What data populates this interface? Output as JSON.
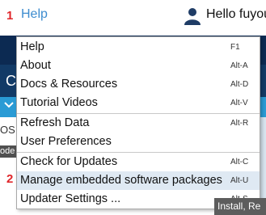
{
  "markers": {
    "step1": "1",
    "step2": "2"
  },
  "header": {
    "help_label": "Help",
    "greeting": "Hello fuyou"
  },
  "background": {
    "nav_letter": "C",
    "os_text": "OS",
    "dark_strip_text": "ode"
  },
  "menu": {
    "items": [
      {
        "label": "Help",
        "shortcut": "F1"
      },
      {
        "label": "About",
        "shortcut": "Alt-A"
      },
      {
        "label": "Docs & Resources",
        "shortcut": "Alt-D"
      },
      {
        "label": "Tutorial Videos",
        "shortcut": "Alt-V"
      },
      {
        "label": "Refresh Data",
        "shortcut": "Alt-R"
      },
      {
        "label": "User Preferences",
        "shortcut": ""
      },
      {
        "label": "Check for Updates",
        "shortcut": "Alt-C"
      },
      {
        "label": "Manage embedded software packages",
        "shortcut": "Alt-U"
      },
      {
        "label": "Updater Settings ...",
        "shortcut": "Alt-S"
      }
    ],
    "selected_index": 7
  },
  "tooltip": {
    "text": "Install, Re"
  },
  "colors": {
    "link": "#3d8ccf",
    "marker": "#e0262b",
    "navy": "#0c2a52",
    "teal": "#2a9bd5",
    "selected_row": "#dfe9f3"
  },
  "icons": {
    "user": "user-icon",
    "chevron": "chevron-down-icon"
  }
}
